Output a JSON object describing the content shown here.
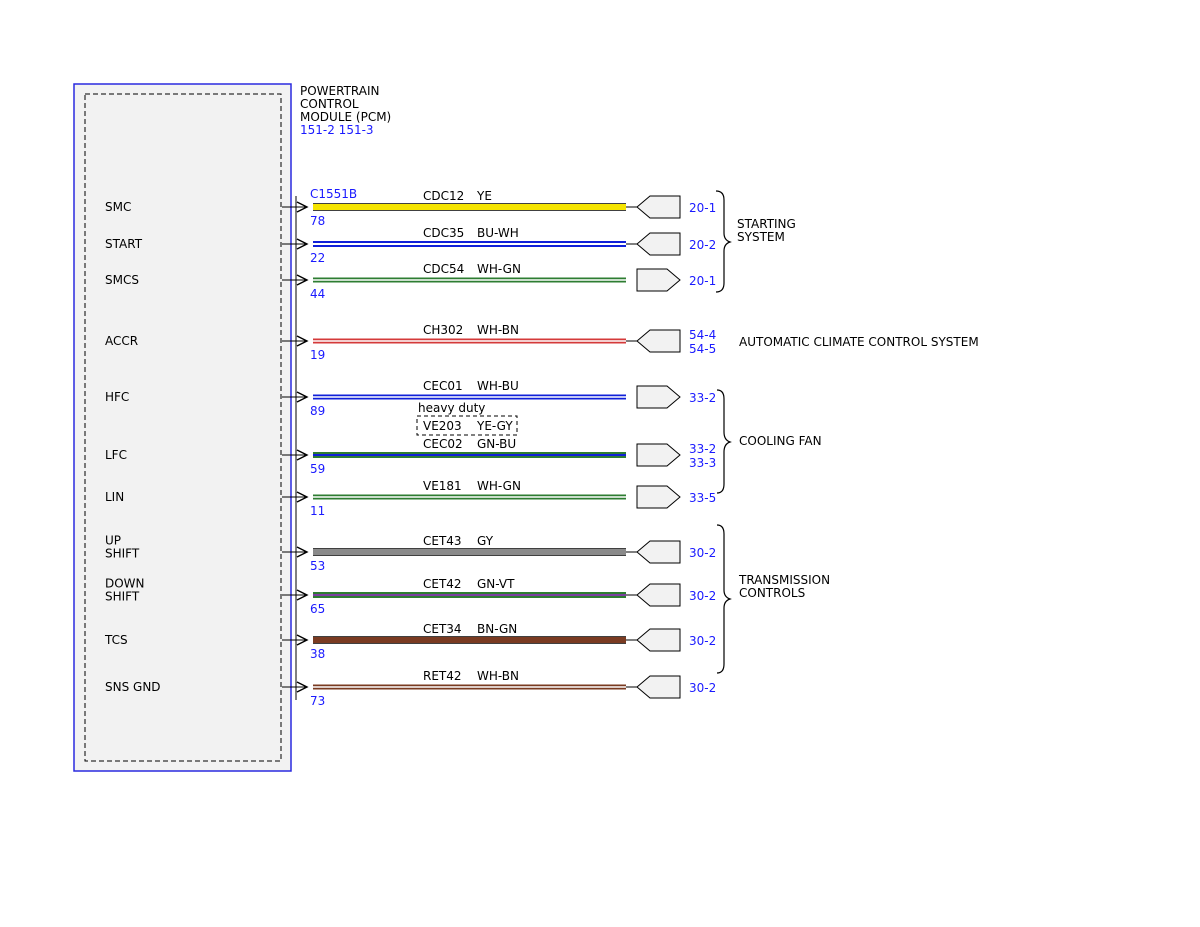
{
  "module": {
    "title_lines": [
      "POWERTRAIN",
      "CONTROL",
      "MODULE (PCM)"
    ],
    "ref": "151-2  151-3",
    "connector": "C1551B"
  },
  "colors": {
    "YE": "#f5e400",
    "BU": "#1020d8",
    "WH": "#ffffff",
    "GN": "#2e7d32",
    "BN": "#7a3b22",
    "RD": "#d43a3a",
    "GY": "#8a8a8a",
    "VT": "#7b3fa0",
    "link": "#1a1aff",
    "module_border": "#2a2adf",
    "module_fill": "#f2f2f2"
  },
  "circuits": [
    {
      "signal": [
        "SMC"
      ],
      "pin": "78",
      "circuit": "CDC12",
      "wire": "YE",
      "stripes": [
        "YE"
      ],
      "connector": "left",
      "refs": [
        "20-1"
      ]
    },
    {
      "signal": [
        "START"
      ],
      "pin": "22",
      "circuit": "CDC35",
      "wire": "BU-WH",
      "stripes": [
        "BU",
        "WH",
        "BU"
      ],
      "connector": "left",
      "refs": [
        "20-2"
      ]
    },
    {
      "signal": [
        "SMCS"
      ],
      "pin": "44",
      "circuit": "CDC54",
      "wire": "WH-GN",
      "stripes": [
        "GN",
        "WH",
        "GN"
      ],
      "connector": "right",
      "refs": [
        "20-1"
      ]
    },
    {
      "signal": [
        "ACCR"
      ],
      "pin": "19",
      "circuit": "CH302",
      "wire": "WH-BN",
      "stripes": [
        "RD",
        "WH",
        "RD"
      ],
      "connector": "left",
      "refs": [
        "54-4",
        "54-5"
      ]
    },
    {
      "signal": [
        "HFC"
      ],
      "pin": "89",
      "circuit": "CEC01",
      "wire": "WH-BU",
      "stripes": [
        "BU",
        "WH",
        "BU"
      ],
      "connector": "right",
      "refs": [
        "33-2"
      ]
    },
    {
      "signal": [
        "LFC"
      ],
      "pin": "59",
      "circuit": "CEC02",
      "wire": "GN-BU",
      "stripes": [
        "GN",
        "BU",
        "GN"
      ],
      "connector": "right",
      "refs": [
        "33-2",
        "33-3"
      ]
    },
    {
      "signal": [
        "LIN"
      ],
      "pin": "11",
      "circuit": "VE181",
      "wire": "WH-GN",
      "stripes": [
        "GN",
        "WH",
        "GN"
      ],
      "connector": "right",
      "refs": [
        "33-5"
      ]
    },
    {
      "signal": [
        "UP",
        "SHIFT"
      ],
      "pin": "53",
      "circuit": "CET43",
      "wire": "GY",
      "stripes": [
        "GY"
      ],
      "connector": "left",
      "refs": [
        "30-2"
      ]
    },
    {
      "signal": [
        "DOWN",
        "SHIFT"
      ],
      "pin": "65",
      "circuit": "CET42",
      "wire": "GN-VT",
      "stripes": [
        "GN",
        "VT",
        "GN"
      ],
      "connector": "left",
      "refs": [
        "30-2"
      ]
    },
    {
      "signal": [
        "TCS"
      ],
      "pin": "38",
      "circuit": "CET34",
      "wire": "BN-GN",
      "stripes": [
        "BN"
      ],
      "connector": "left",
      "refs": [
        "30-2"
      ]
    },
    {
      "signal": [
        "SNS GND"
      ],
      "pin": "73",
      "circuit": "RET42",
      "wire": "WH-BN",
      "stripes": [
        "BN",
        "WH",
        "BN"
      ],
      "connector": "left",
      "refs": [
        "30-2"
      ]
    }
  ],
  "option": {
    "label": "heavy duty",
    "circuit": "VE203",
    "wire": "YE-GY"
  },
  "systems": [
    {
      "lines": [
        "STARTING",
        "SYSTEM"
      ],
      "bracket": true
    },
    {
      "lines": [
        "AUTOMATIC CLIMATE CONTROL SYSTEM"
      ],
      "bracket": false
    },
    {
      "lines": [
        "COOLING FAN"
      ],
      "bracket": true
    },
    {
      "lines": [
        "TRANSMISSION",
        "CONTROLS"
      ],
      "bracket": true
    }
  ]
}
